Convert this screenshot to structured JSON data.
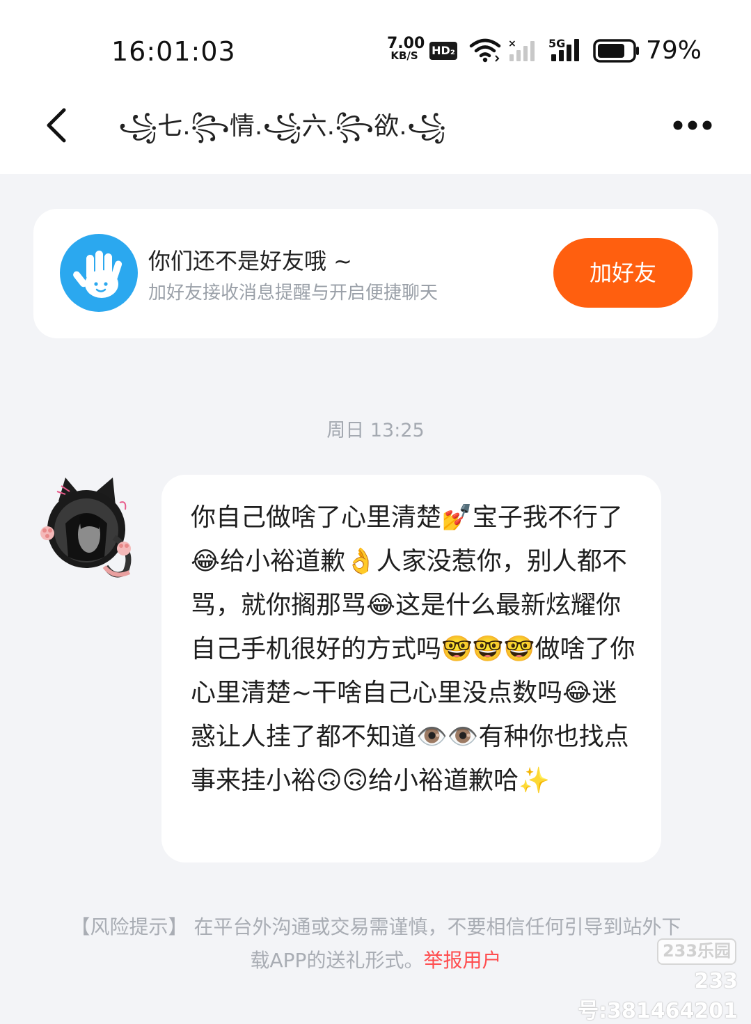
{
  "status_bar": {
    "time": "16:01:03",
    "net_speed": "7.00",
    "net_speed_unit": "KB/S",
    "hd_label": "HD₂",
    "signal_label": "5G",
    "battery_percent": "79%",
    "battery_level": 0.79
  },
  "nav": {
    "title": "꧁七.꧂情.꧁六.꧂欲.꧁"
  },
  "friend_card": {
    "title": "你们还不是好友哦 ~",
    "subtitle": "加好友接收消息提醒与开启便捷聊天",
    "add_button_label": "加好友",
    "accent_color": "#ff5f0f",
    "icon_color": "#2ba8ef"
  },
  "chat": {
    "timestamp": "周日 13:25",
    "message": "你自己做啥了心里清楚💅宝子我不行了😂给小裕道歉👌人家没惹你，别人都不骂，就你搁那骂😂这是什么最新炫耀你自己手机很好的方式吗🤓🤓🤓做啥了你心里清楚~干啥自己心里没点数吗😂迷惑让人挂了都不知道👁️👁️有种你也找点事来挂小裕🙃🙃给小裕道歉哈✨"
  },
  "footer": {
    "risk_label": "【风险提示】",
    "risk_text": " 在平台外沟通或交易需谨慎，不要相信任何引导到站外下载APP的送礼形式。",
    "report_link": "举报用户",
    "watermark_logo": "233乐园",
    "watermark_id": "233号:381464201"
  }
}
